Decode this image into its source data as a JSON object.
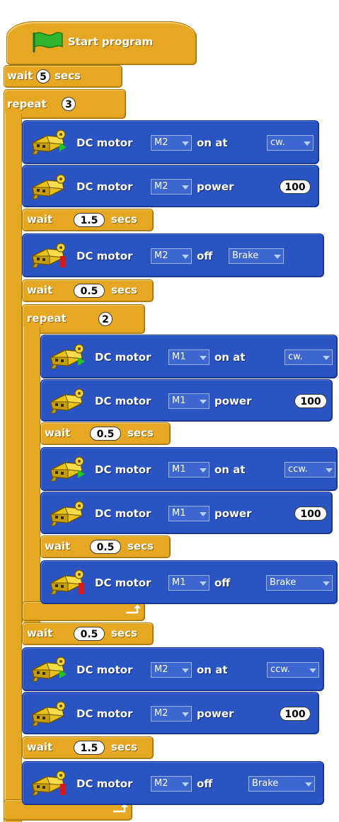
{
  "program": {
    "hat_label": "Start program",
    "secs_label": "secs",
    "wait_label": "wait",
    "repeat_label": "repeat",
    "dc_motor_label": "DC motor",
    "on_at_label": "on at",
    "power_label": "power",
    "off_label": "off"
  },
  "blocks": {
    "wait1": "5",
    "repeat1": "3",
    "m1_motor": "M2",
    "m1_dir": "cw.",
    "m2_motor": "M2",
    "m2_power": "100",
    "wait2": "1.5",
    "m3_motor": "M2",
    "m3_mode": "Brake",
    "wait3": "0.5",
    "repeat2": "2",
    "n1_motor": "M1",
    "n1_dir": "cw.",
    "n2_motor": "M1",
    "n2_power": "100",
    "wait4": "0.5",
    "n3_motor": "M1",
    "n3_dir": "ccw.",
    "n4_motor": "M1",
    "n4_power": "100",
    "wait5": "0.5",
    "n5_motor": "M1",
    "n5_mode": "Brake",
    "wait6": "0.5",
    "p1_motor": "M2",
    "p1_dir": "ccw.",
    "p2_motor": "M2",
    "p2_power": "100",
    "wait7": "1.5",
    "p3_motor": "M2",
    "p3_mode": "Brake"
  },
  "colors": {
    "control": "#e6a822",
    "motor": "#2a54c2",
    "flag": "#2fb52f",
    "on_indicator": "#23c41e",
    "off_indicator": "#d81818"
  },
  "icons": {
    "hat": "green-flag-icon",
    "motor_on": "motor-on-icon",
    "motor_power": "motor-icon",
    "motor_off": "motor-off-icon",
    "loop_return": "loop-arrow-icon"
  }
}
